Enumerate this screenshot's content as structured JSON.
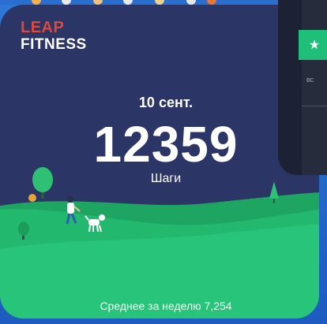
{
  "widget": {
    "logo_top": "LEAP",
    "logo_bottom": "FITNESS",
    "date": "10 сент.",
    "steps": "12359",
    "steps_label": "Шаги",
    "weekly_average": "Среднее за неделю 7,254"
  },
  "side_panel": {
    "star_icon": "★",
    "day_label": "вс"
  },
  "colors": {
    "card_bg": "#2b3566",
    "hill_green": "#22b86e",
    "accent_green": "#1fbf7a",
    "logo_red": "#e0483c"
  }
}
